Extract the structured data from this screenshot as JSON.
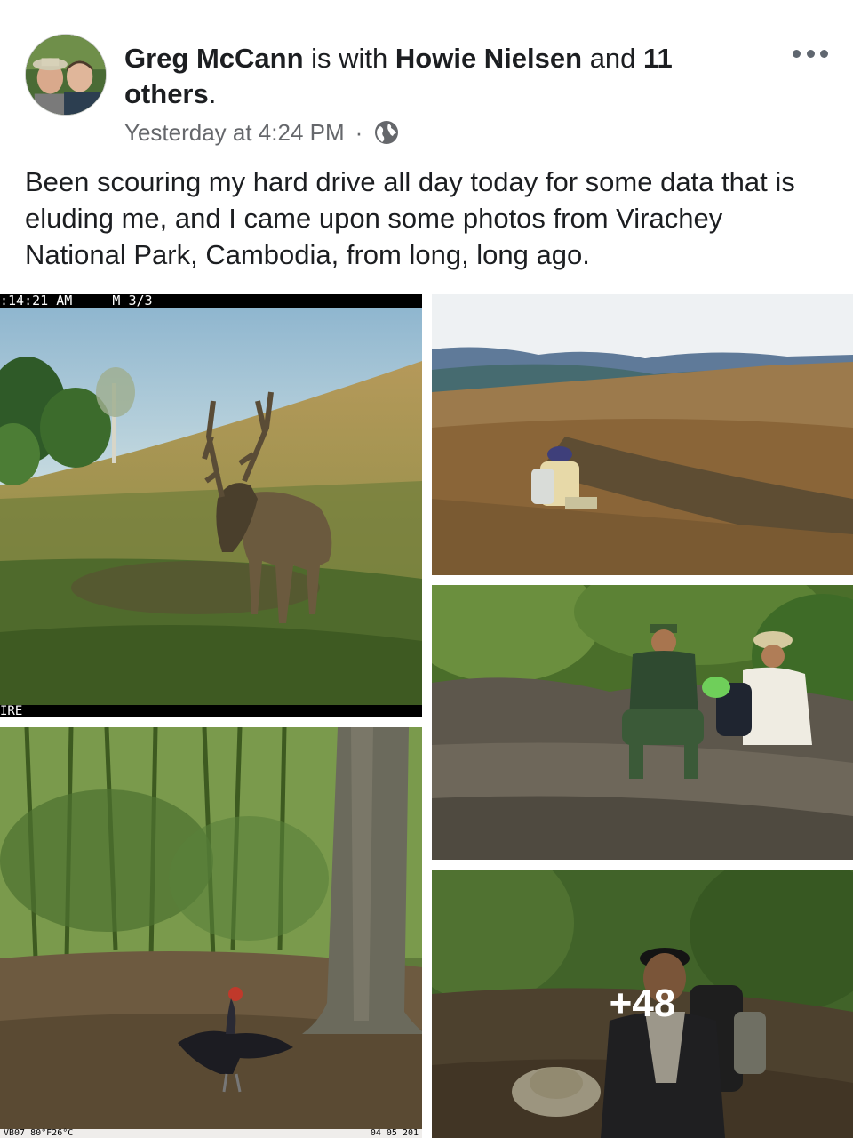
{
  "post": {
    "author": "Greg McCann",
    "with_word": " is with ",
    "tagged": "Howie Nielsen",
    "and_word": " and ",
    "others": "11 others",
    "period": ".",
    "timestamp": "Yesterday at 4:24 PM",
    "separator": "·",
    "privacy_icon": "globe-icon",
    "more_icon": "more-options-icon",
    "text": "Been scouring my hard drive all day today for some data that is eluding me, and I came upon some photos from Virachey National Park, Cambodia, from long, long ago."
  },
  "photos": {
    "p1": {
      "stamp_top": ":14:21 AM     M 3/3",
      "stamp_bottom": "IRE"
    },
    "p3": {
      "stamp_left": "VB07   80°F26°C",
      "stamp_right": "04 05 201"
    },
    "p5": {
      "more_count": "+48"
    }
  },
  "colors": {
    "text": "#1c1e21",
    "secondary": "#65676b",
    "overlay_text": "#ffffff"
  }
}
